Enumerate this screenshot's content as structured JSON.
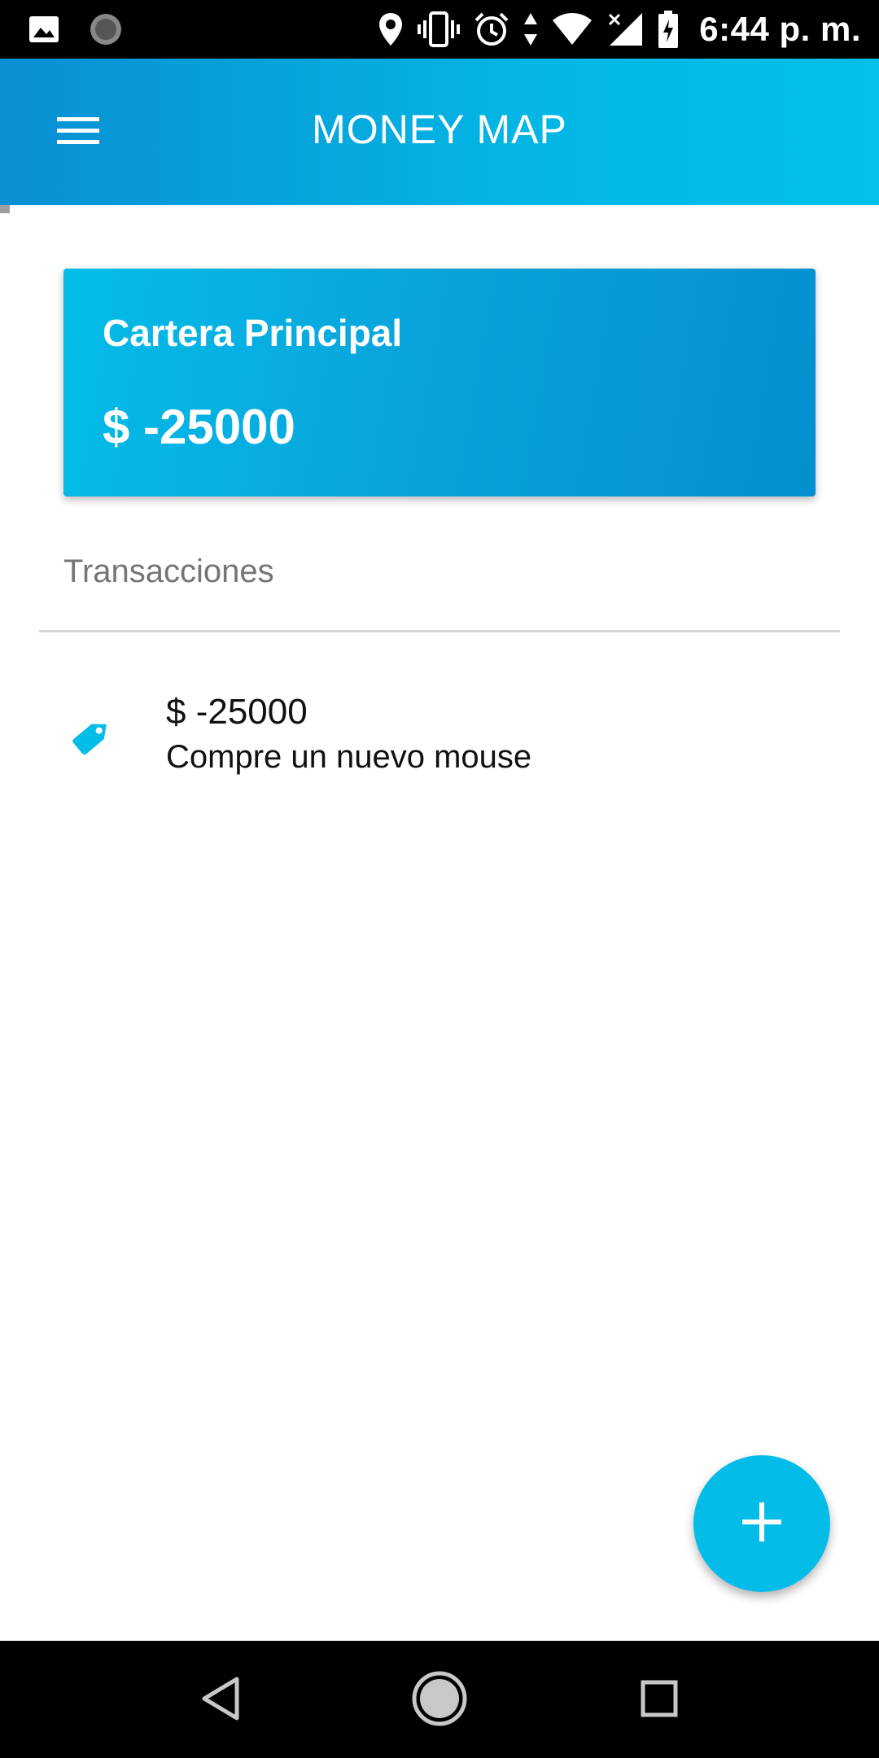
{
  "status_bar": {
    "time": "6:44 p. m.",
    "left_icons": [
      "image-icon",
      "loading-icon"
    ],
    "right_icons": [
      "location-icon",
      "vibrate-icon",
      "alarm-icon",
      "data-arrows-icon",
      "wifi-icon",
      "signal-icon",
      "battery-icon"
    ]
  },
  "app_bar": {
    "title": "MONEY MAP",
    "menu_icon": "hamburger-menu-icon"
  },
  "wallet": {
    "name": "Cartera Principal",
    "balance": "$ -25000"
  },
  "transactions": {
    "heading": "Transacciones",
    "items": [
      {
        "icon": "tag-icon",
        "amount": "$ -25000",
        "description": "Compre un nuevo mouse"
      }
    ]
  },
  "fab": {
    "icon": "plus-icon"
  },
  "nav_bar": {
    "buttons": [
      "back-icon",
      "home-icon",
      "recents-icon"
    ]
  },
  "colors": {
    "primary": "#03bde8",
    "primary_dark": "#0390d0",
    "text_secondary": "#757575"
  }
}
